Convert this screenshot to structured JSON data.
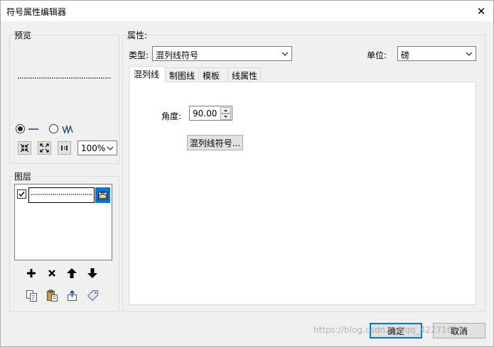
{
  "window": {
    "title": "符号属性编辑器",
    "close_glyph": "✕"
  },
  "preview": {
    "title": "预览",
    "radio_line": {
      "selected": true
    },
    "radio_wave": {
      "selected": false
    },
    "zoom_value": "100%"
  },
  "layers": {
    "title": "图层",
    "items": [
      {
        "checked": true,
        "selected": true
      }
    ]
  },
  "properties": {
    "title": "属性:",
    "type_label": "类型:",
    "type_value": "混列线符号",
    "unit_label": "单位:",
    "unit_value": "磅",
    "tabs": [
      {
        "label": "混列线",
        "active": true
      },
      {
        "label": "制图线",
        "active": false
      },
      {
        "label": "模板",
        "active": false
      },
      {
        "label": "线属性",
        "active": false
      }
    ],
    "angle_label": "角度:",
    "angle_value": "90.00",
    "hash_symbol_button": "混列线符号..."
  },
  "footer": {
    "ok_label": "确定",
    "cancel_label": "取消"
  },
  "watermark": "https://blog.csdn.net/qq_42271697",
  "colors": {
    "selection_blue": "#0078d7",
    "focus_border": "#0078d7"
  }
}
